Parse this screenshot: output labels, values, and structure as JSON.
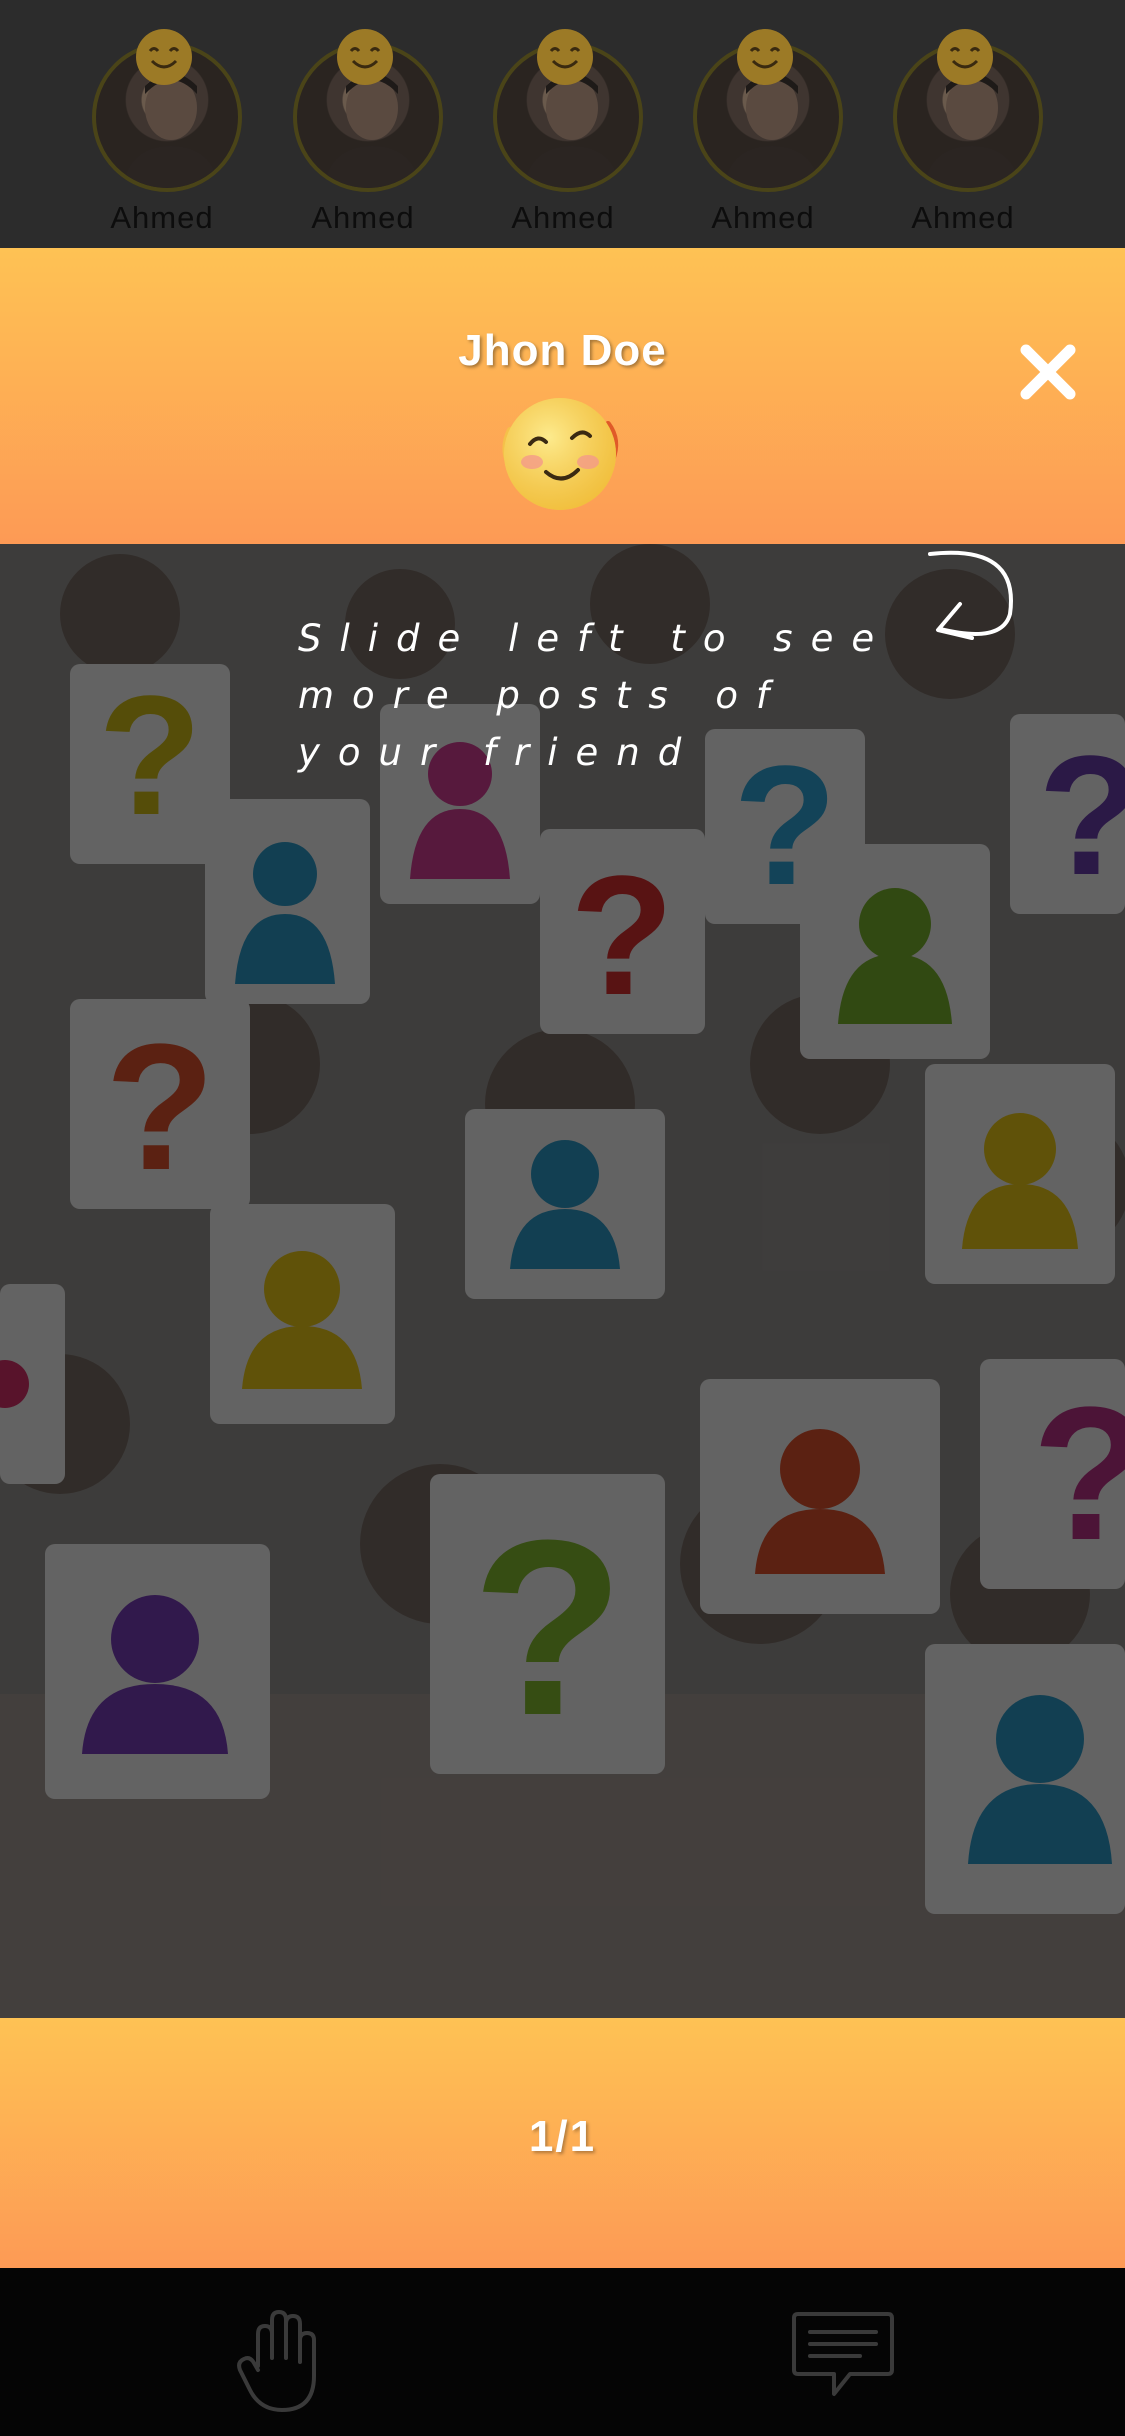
{
  "friends": [
    {
      "name": "Ahmed"
    },
    {
      "name": "Ahmed"
    },
    {
      "name": "Ahmed"
    },
    {
      "name": "Ahmed"
    },
    {
      "name": "Ahmed"
    }
  ],
  "header": {
    "title": "Jhon Doe",
    "mood_icon": "smiling-emoji-icon",
    "close_icon": "close-icon"
  },
  "post": {
    "hint": "Slide left to see more posts of your friend",
    "image_description_icon": "crowd-photo"
  },
  "pager": {
    "count": "1/1"
  },
  "bottom_bar": {
    "left_icon": "hand-wave-icon",
    "right_icon": "chat-icon"
  },
  "colors": {
    "accent_top": "#fec254",
    "accent_bottom": "#fd9a55",
    "bar": "#050505"
  }
}
